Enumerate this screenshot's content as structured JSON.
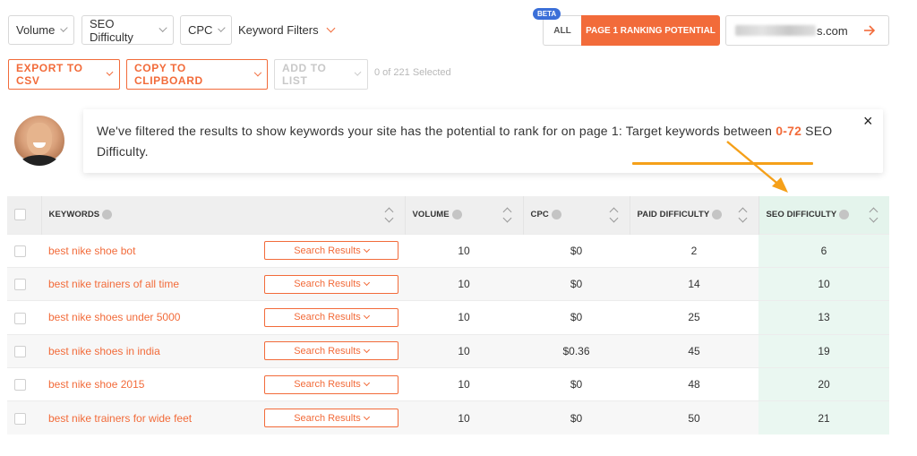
{
  "filters": {
    "volume": "Volume",
    "seo_difficulty": "SEO Difficulty",
    "cpc": "CPC",
    "keyword_filters": "Keyword Filters"
  },
  "toggle": {
    "beta": "BETA",
    "all": "ALL",
    "page1": "PAGE 1 RANKING POTENTIAL"
  },
  "domain": {
    "suffix": "s.com"
  },
  "actions": {
    "export_csv": "EXPORT TO CSV",
    "copy_clipboard": "COPY TO CLIPBOARD",
    "add_to_list": "ADD TO LIST",
    "selected": "0 of 221 Selected"
  },
  "message": {
    "part1": "We've filtered the results to show keywords your site has the potential to rank for on page 1: Target keywords between ",
    "range": "0-72",
    "part2": " SEO Difficulty."
  },
  "table": {
    "headers": {
      "keywords": "KEYWORDS",
      "volume": "VOLUME",
      "cpc": "CPC",
      "paid_difficulty": "PAID DIFFICULTY",
      "seo_difficulty": "SEO DIFFICULTY"
    },
    "search_results_label": "Search Results",
    "rows": [
      {
        "keyword": "best nike shoe bot",
        "volume": "10",
        "cpc": "$0",
        "paid": "2",
        "seo": "6"
      },
      {
        "keyword": "best nike trainers of all time",
        "volume": "10",
        "cpc": "$0",
        "paid": "14",
        "seo": "10"
      },
      {
        "keyword": "best nike shoes under 5000",
        "volume": "10",
        "cpc": "$0",
        "paid": "25",
        "seo": "13"
      },
      {
        "keyword": "best nike shoes in india",
        "volume": "10",
        "cpc": "$0.36",
        "paid": "45",
        "seo": "19"
      },
      {
        "keyword": "best nike shoe 2015",
        "volume": "10",
        "cpc": "$0",
        "paid": "48",
        "seo": "20"
      },
      {
        "keyword": "best nike trainers for wide feet",
        "volume": "10",
        "cpc": "$0",
        "paid": "50",
        "seo": "21"
      }
    ]
  },
  "colors": {
    "accent": "#f26b3a",
    "annotation": "#f5a019",
    "beta": "#3b6fd8",
    "seo_highlight": "#eaf7f1"
  }
}
